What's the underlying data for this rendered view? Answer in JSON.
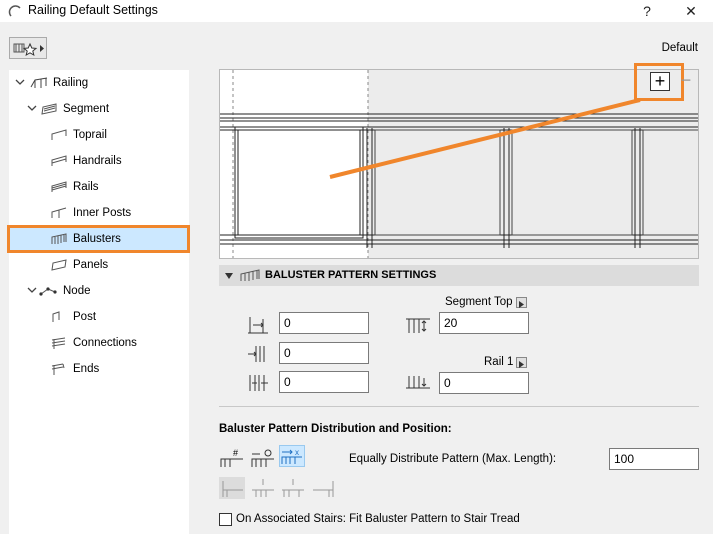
{
  "window": {
    "title": "Railing Default Settings",
    "help_label": "?",
    "close_label": "✕",
    "preset_label": "Default"
  },
  "tree": {
    "items": [
      {
        "label": "Railing",
        "icon": "railing-icon",
        "expanded": true
      },
      {
        "label": "Segment",
        "icon": "segment-icon",
        "expanded": true
      },
      {
        "label": "Toprail",
        "icon": "toprail-icon"
      },
      {
        "label": "Handrails",
        "icon": "handrails-icon"
      },
      {
        "label": "Rails",
        "icon": "rails-icon"
      },
      {
        "label": "Inner Posts",
        "icon": "inner-posts-icon"
      },
      {
        "label": "Balusters",
        "icon": "balusters-icon",
        "selected": true
      },
      {
        "label": "Panels",
        "icon": "panels-icon"
      },
      {
        "label": "Node",
        "icon": "node-icon",
        "expanded": true
      },
      {
        "label": "Post",
        "icon": "post-icon"
      },
      {
        "label": "Connections",
        "icon": "connections-icon"
      },
      {
        "label": "Ends",
        "icon": "ends-icon"
      }
    ]
  },
  "preview": {
    "zoom_in_label": "+",
    "zoom_out_label": "−"
  },
  "pattern": {
    "header": "BALUSTER PATTERN SETTINGS",
    "left_fields": [
      "0",
      "0",
      "0"
    ],
    "segment_top_label": "Segment Top",
    "segment_top_value": "20",
    "rail_label": "Rail 1",
    "rail_value": "0"
  },
  "distribution": {
    "title": "Baluster Pattern Distribution and Position:",
    "mode_label": "Equally Distribute Pattern (Max. Length):",
    "mode_value": "100",
    "stairs_label": "On Associated Stairs: Fit Baluster Pattern to Stair Tread",
    "stairs_checked": false
  },
  "colors": {
    "highlight": "#f0862c",
    "selection": "#cce8ff",
    "accent": "#1f6fc2"
  }
}
